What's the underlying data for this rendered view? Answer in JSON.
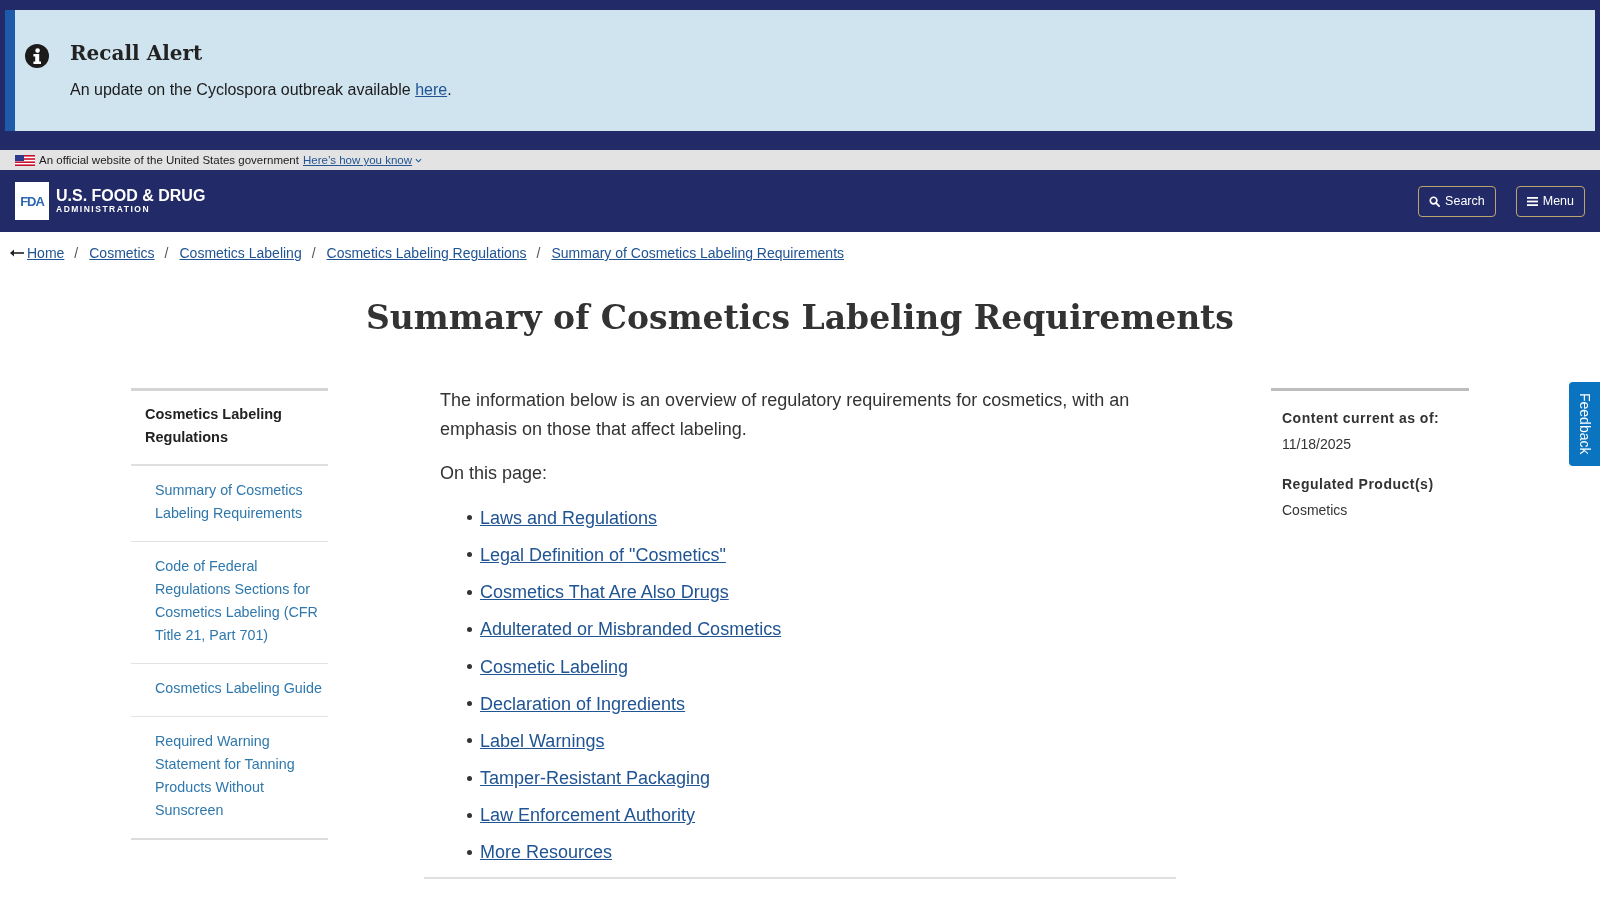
{
  "recall_alert": {
    "title": "Recall Alert",
    "message": "An update on the Cyclospora outbreak available",
    "link": "here",
    "trailing": "."
  },
  "gov_banner": {
    "text": "An official website of the United States government",
    "link": "Here’s how you know"
  },
  "header": {
    "logo": {
      "mark": "FDA",
      "name": "U.S. FOOD & DRUG",
      "subtitle": "ADMINISTRATION"
    },
    "buttons": [
      {
        "kind": "search",
        "label": "Search"
      },
      {
        "kind": "menu",
        "label": "Menu"
      }
    ]
  },
  "breadcrumb": [
    {
      "label": "Home",
      "separator": "/"
    },
    {
      "label": "Cosmetics",
      "separator": "/"
    },
    {
      "label": "Cosmetics Labeling",
      "separator": "/"
    },
    {
      "label": "Cosmetics Labeling Regulations",
      "separator": "/"
    },
    {
      "label": "Summary of Cosmetics Labeling Requirements"
    }
  ],
  "page_title": "Summary of Cosmetics Labeling Requirements",
  "sidebar": {
    "title": "Cosmetics Labeling Regulations",
    "items": [
      "Summary of Cosmetics Labeling Requirements",
      "Code of Federal Regulations Sections for Cosmetics Labeling (CFR Title 21, Part 701)",
      "Cosmetics Labeling Guide",
      "Required Warning Statement for Tanning Products Without Sunscreen"
    ]
  },
  "content": {
    "intro": "The information below is an overview of regulatory requirements for cosmetics, with an emphasis on those that affect labeling.",
    "on_this_page": "On this page:",
    "links": [
      "Laws and Regulations",
      "Legal Definition of \"Cosmetics\"",
      "Cosmetics That Are Also Drugs",
      "Adulterated or Misbranded Cosmetics",
      "Cosmetic Labeling",
      "Declaration of Ingredients",
      "Label Warnings",
      "Tamper-Resistant Packaging",
      "Law Enforcement Authority",
      "More Resources"
    ]
  },
  "aside": {
    "fields": [
      {
        "label": "Content current as of:",
        "value": "11/18/2025"
      },
      {
        "label": "Regulated Product(s)",
        "value": "Cosmetics"
      }
    ]
  },
  "feedback_tab": {
    "label": "Feedback"
  }
}
